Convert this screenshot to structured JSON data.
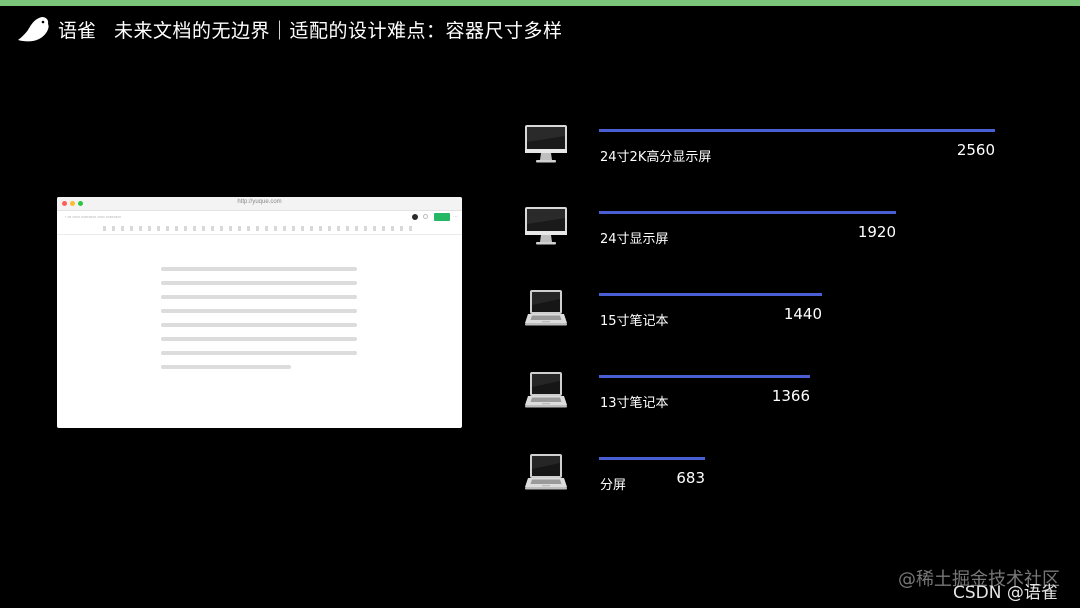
{
  "header": {
    "brand": "语雀",
    "title": "未来文档的无边界｜适配的设计难点：容器尺寸多样"
  },
  "browser_mock": {
    "url": "http://yuque.com",
    "dot_colors": [
      "#ff5f57",
      "#febc2e",
      "#28c840"
    ],
    "publish_color": "#25b864"
  },
  "chart_data": {
    "type": "bar",
    "orientation": "horizontal",
    "categories": [
      "24寸2K高分显示屏",
      "24寸显示屏",
      "15寸笔记本",
      "13寸笔记本",
      "分屏"
    ],
    "values": [
      2560,
      1920,
      1440,
      1366,
      683
    ],
    "device_icons": [
      "monitor-icon",
      "monitor-icon",
      "laptop-icon",
      "laptop-icon",
      "laptop-icon"
    ],
    "bar_color": "#4a5fd4",
    "xlim": [
      0,
      2560
    ]
  },
  "watermarks": {
    "juejin": "@稀土掘金技术社区",
    "csdn": "CSDN @语雀"
  }
}
